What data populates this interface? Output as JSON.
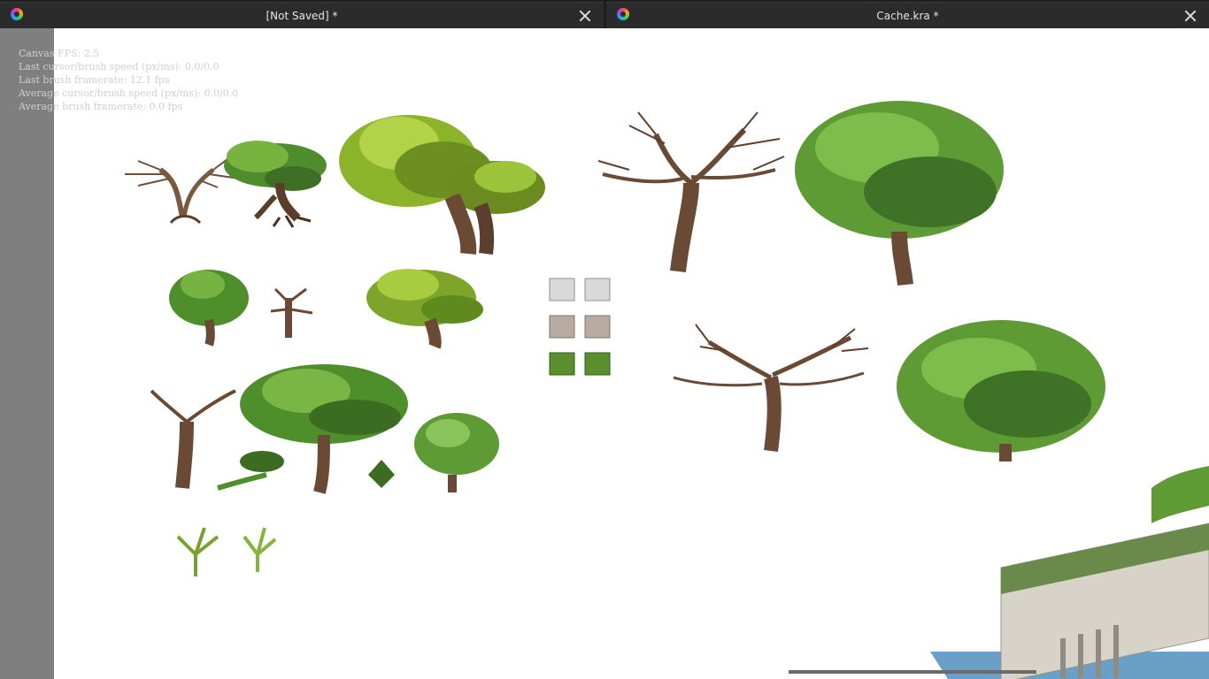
{
  "tabs": [
    {
      "title": "[Not Saved]  *"
    },
    {
      "title": "Cache.kra *"
    }
  ],
  "overlay": {
    "lines": [
      "Canvas FPS: 2.5",
      "Last cursor/brush speed (px/ms): 0.0/0.0",
      "Last brush framerate: 12.1 fps",
      "Average cursor/brush speed (px/ms): 0.0/0.0",
      "Average brush framerate: 0.0 fps"
    ]
  },
  "icons": {
    "app": "krita-icon",
    "close": "close-icon"
  },
  "colors": {
    "tabbar": "#1e1e1e",
    "tab": "#2b2b2b",
    "left_strip": "#7f7f7f",
    "canvas": "#ffffff"
  }
}
